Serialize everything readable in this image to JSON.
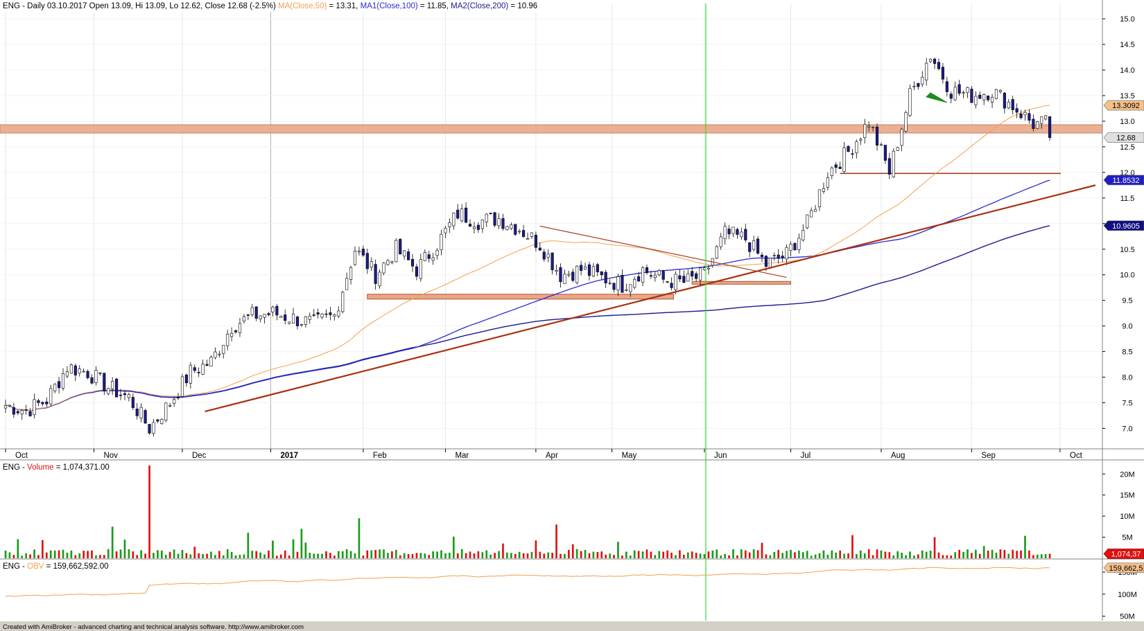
{
  "header": {
    "ticker": "ENG",
    "info": " - Daily 03.10.2017 Open 13.09, Hi 13.09, Lo 12.62, Close 12.68 (-2.5%)",
    "ma_label": "MA(Close,50)",
    "ma_value": " = 13.31,",
    "ma1_label": "MA1(Close,100)",
    "ma1_value": " = 11.85,",
    "ma2_label": "MA2(Close,200)",
    "ma2_value": " = 10.96"
  },
  "volume_panel": {
    "ticker": "ENG",
    "label": "Volume",
    "value": " = 1,074,371.00",
    "axis_labels": [
      "20M",
      "15M",
      "10M",
      "5M"
    ],
    "last_badge": "1,074,37"
  },
  "obv_panel": {
    "ticker": "ENG",
    "label": "OBV",
    "value": " = 159,662,592.00",
    "axis_labels": [
      "150M",
      "100M",
      "50M"
    ],
    "last_badge": "159,662,5"
  },
  "footer": {
    "text": "Created with AmiBroker - advanced charting and technical analysis software. http://www.amibroker.com"
  },
  "colors": {
    "bull": "#ffffff",
    "bear": "#1c1c8c",
    "ma50": "#f0a050",
    "ma100": "#2a2ad0",
    "ma200": "#1a1a90",
    "trend": "#a83010",
    "zone": "#e8a888",
    "cursor": "#33dd33",
    "vol_up": "#1a9a1a",
    "vol_down": "#e01010"
  },
  "chart_data": {
    "type": "candlestick",
    "price_axis": {
      "min": 6.6,
      "max": 15.3,
      "ticks": [
        "7.0",
        "7.5",
        "8.0",
        "8.5",
        "9.0",
        "9.5",
        "10.0",
        "10.5",
        "11.0",
        "11.5",
        "12.0",
        "12.5",
        "13.0",
        "13.5",
        "14.0",
        "14.5",
        "15.0"
      ]
    },
    "x_months": [
      {
        "label": "Oct",
        "week": 0
      },
      {
        "label": "Nov",
        "week": 4.3
      },
      {
        "label": "Dec",
        "week": 8.6
      },
      {
        "label": "2017",
        "week": 12.9
      },
      {
        "label": "Feb",
        "week": 17.4
      },
      {
        "label": "Mar",
        "week": 21.4
      },
      {
        "label": "Apr",
        "week": 25.8
      },
      {
        "label": "May",
        "week": 29.5
      },
      {
        "label": "Jun",
        "week": 34.0
      },
      {
        "label": "Jul",
        "week": 38.2
      },
      {
        "label": "Aug",
        "week": 42.6
      },
      {
        "label": "Sep",
        "week": 47.0
      },
      {
        "label": "Oct",
        "week": 51.3
      }
    ],
    "weekly_close": [
      7.45,
      7.35,
      7.55,
      8.2,
      8.1,
      7.8,
      7.6,
      7.0,
      7.5,
      8.1,
      8.3,
      9.0,
      9.2,
      9.25,
      9.15,
      9.05,
      9.2,
      10.5,
      10.0,
      10.5,
      10.1,
      10.6,
      11.2,
      11.05,
      11.1,
      10.9,
      10.6,
      10.0,
      10.1,
      9.95,
      9.8,
      10.1,
      9.9,
      9.85,
      10.0,
      10.8,
      10.7,
      10.2,
      10.4,
      11.0,
      12.0,
      12.4,
      13.0,
      12.0,
      13.5,
      14.3,
      13.6,
      13.5,
      13.6,
      13.3,
      12.95
    ],
    "last": {
      "open": 13.09,
      "high": 13.09,
      "low": 12.62,
      "close": 12.68
    },
    "ma50": 13.31,
    "ma100": 11.85,
    "ma200": 10.96,
    "price_badges": [
      "13.3092",
      "12.68",
      "11.8532",
      "10.9605"
    ],
    "series": [
      {
        "name": "MA(Close,50)"
      },
      {
        "name": "MA1(Close,100)"
      },
      {
        "name": "MA2(Close,200)"
      }
    ]
  }
}
